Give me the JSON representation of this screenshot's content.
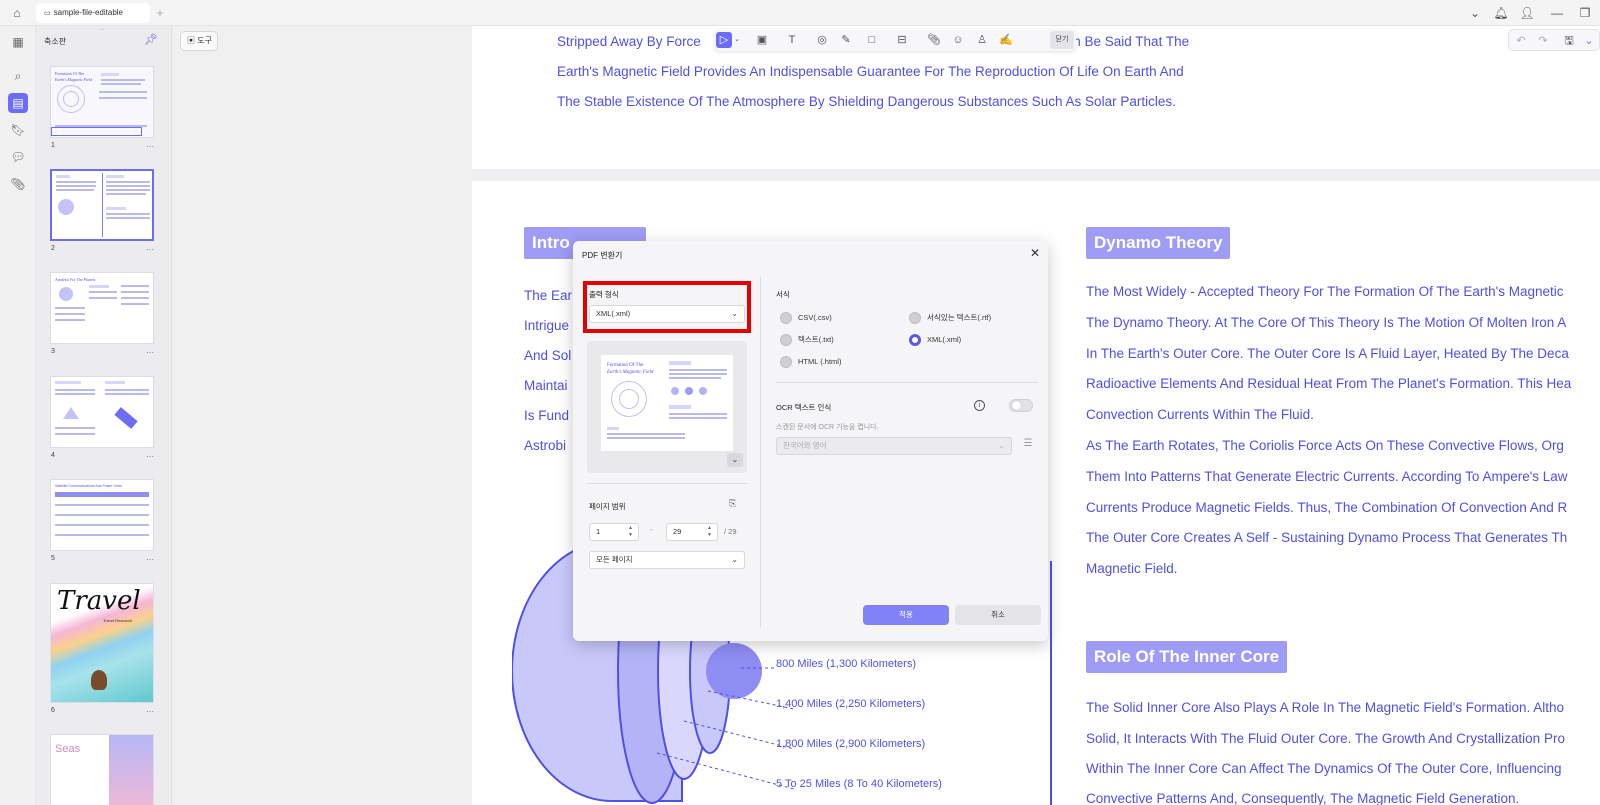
{
  "app": {
    "tab_title": "sample-file-editable",
    "new_tab": "+"
  },
  "sidebar": {
    "panel_title": "축소판",
    "thumbnails": [
      {
        "num": "1",
        "more": "···"
      },
      {
        "num": "2",
        "more": "···"
      },
      {
        "num": "3",
        "more": "···"
      },
      {
        "num": "4",
        "more": "···"
      },
      {
        "num": "5",
        "more": "···"
      },
      {
        "num": "6",
        "more": "···",
        "title": "Travel",
        "subtitle": "Travel Research"
      },
      {
        "num": "",
        "more": "",
        "title": "Seas"
      }
    ],
    "thumb_texts": {
      "t1": "Formation Of The",
      "t1b": "Earth's Magnetic Field",
      "t3": "Analysis For The Planets",
      "t5": "Satellite Communications And Power Grids"
    }
  },
  "toolbar": {
    "tools_label": "도구",
    "close_label": "닫기"
  },
  "document": {
    "page1_lines": [
      "Stripped Away By Force",
      "Can Be Said That The",
      "Earth's Magnetic Field Provides An Indispensable Guarantee For The Reproduction Of Life On Earth And",
      "The Stable Existence Of The Atmosphere By Shielding Dangerous Substances Such As Solar Particles."
    ],
    "intro_heading": "Intro",
    "intro_lines": [
      "The Ear",
      "Intrigue",
      "And Sol",
      "Maintai",
      "Is Fund",
      "Astrobi"
    ],
    "dynamo_heading": "Dynamo Theory",
    "dynamo_lines": [
      "The Most Widely - Accepted Theory For The Formation Of The Earth's Magnetic",
      "The Dynamo Theory. At The Core Of This Theory Is The Motion Of Molten Iron A",
      "In The Earth's Outer Core. The Outer Core Is A Fluid Layer, Heated By The Deca",
      "Radioactive Elements And Residual Heat From The Planet's Formation. This Hea",
      "Convection Currents Within The Fluid.",
      "As The Earth Rotates, The Coriolis Force Acts On These Convective Flows, Org",
      "Them Into Patterns That Generate Electric Currents. According To Ampere's Law",
      "Currents Produce Magnetic Fields. Thus, The Combination Of Convection And R",
      "The Outer Core Creates A Self - Sustaining Dynamo Process That Generates Th",
      "Magnetic Field."
    ],
    "role_heading": "Role Of The Inner Core",
    "role_lines": [
      "The Solid Inner Core Also Plays A Role In The Magnetic Field's Formation. Altho",
      "Solid, It Interacts With The Fluid Outer Core. The Growth And Crystallization Pro",
      "Within The Inner Core Can Affect The Dynamics Of The Outer Core, Influencing",
      "Convective Patterns And, Consequently, The Magnetic Field Generation."
    ],
    "diagram_labels": [
      "800 Miles (1,300 Kilometers)",
      "1,400 Miles (2,250 Kilometers)",
      "1,800 Miles (2,900 Kilometers)",
      "5 To 25 Miles (8 To 40 Kilometers)"
    ]
  },
  "dialog": {
    "title": "PDF 변환기",
    "output_format_label": "출력 형식",
    "output_format_value": "XML(.xml)",
    "page_range_label": "페이지 범위",
    "page_from": "1",
    "page_to": "29",
    "page_total": "/ 29",
    "range_dash": "-",
    "page_subset": "모든 페이지",
    "format_label": "서식",
    "format_options": [
      {
        "label": "CSV(.csv)",
        "selected": false
      },
      {
        "label": "서식있는 텍스트(.rtf)",
        "selected": false
      },
      {
        "label": "텍스트(.txt)",
        "selected": false
      },
      {
        "label": "XML(.xml)",
        "selected": true
      },
      {
        "label": "HTML (.html)",
        "selected": false
      }
    ],
    "ocr_label": "OCR 텍스트 인식",
    "ocr_hint": "스캔된 문서에 OCR 기능을 켭니다.",
    "ocr_language": "한국어와 영어",
    "ocr_enabled": false,
    "apply_label": "적용",
    "cancel_label": "취소"
  },
  "colors": {
    "accent": "#6d6cf5",
    "doc_text": "#5050e6",
    "highlight": "#e60000"
  }
}
